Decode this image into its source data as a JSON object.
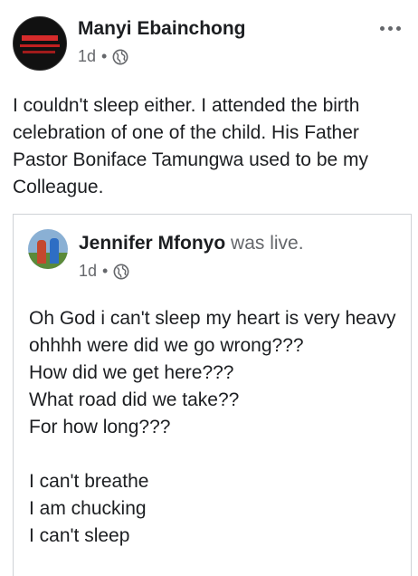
{
  "post": {
    "author": "Manyi Ebainchong",
    "time": "1d",
    "separator": "•",
    "text": "I couldn't sleep either. I attended the birth celebration of one of the child. His Father Pastor Boniface Tamungwa used to be my Colleague."
  },
  "shared": {
    "author": "Jennifer Mfonyo",
    "suffix": " was live.",
    "time": "1d",
    "separator": "•",
    "lines": [
      "Oh God i can't sleep my heart is very heavy ohhhh were did we go wrong???",
      "How did we get here???",
      "What road did we take??",
      "For how long???",
      "",
      "I can't breathe",
      "I am chucking",
      "I can't sleep"
    ]
  },
  "icons": {
    "privacy": "globe-icon",
    "menu": "more-options-icon"
  }
}
